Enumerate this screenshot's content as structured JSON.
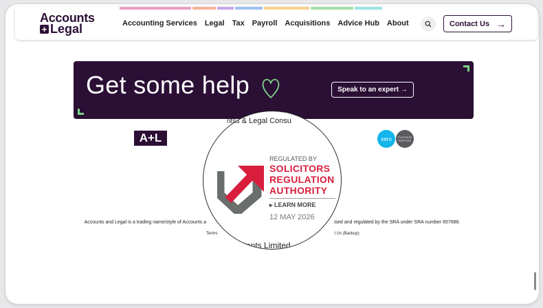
{
  "header": {
    "logo_line1": "Accounts",
    "logo_plus": "+",
    "logo_line2": "Legal",
    "nav": [
      "Accounting Services",
      "Legal",
      "Tax",
      "Payroll",
      "Acquisitions",
      "Advice Hub",
      "About"
    ],
    "search_icon": "search-icon",
    "contact_label": "Contact Us",
    "contact_arrow": "→",
    "color_strip": [
      "#e9a0c4",
      "#f5b49a",
      "#c8a6e6",
      "#9fc3ef",
      "#f6d28d",
      "#a5e0a8",
      "#9ee3e2"
    ]
  },
  "banner": {
    "title": "Get some help",
    "button_label": "Speak to an expert →",
    "background": "#2b0f35",
    "accent": "#7dd389"
  },
  "footer": {
    "al_logo": "A+L",
    "xero_label": "xero",
    "platinum_label": "PLATINUM PARTNER",
    "partial_heading": "nts & Legal Consu",
    "legal_text_left": "Accounts and Legal is a trading name/style of Accounts a",
    "legal_text_right": "ised and regulated by the SRA under SRA number 657688.",
    "links": [
      "Terms",
      "t Us (Backup)"
    ]
  },
  "sra_badge": {
    "top_text": "nts & Legal Consu",
    "regulated_by": "REGULATED BY",
    "name_line1": "SOLICITORS",
    "name_line2": "REGULATION",
    "name_line3": "AUTHORITY",
    "learn_more": "▸ LEARN MORE",
    "date": "12 MAY 2026",
    "bottom_text": "ltants Limited",
    "brand_color": "#d81e3c"
  }
}
